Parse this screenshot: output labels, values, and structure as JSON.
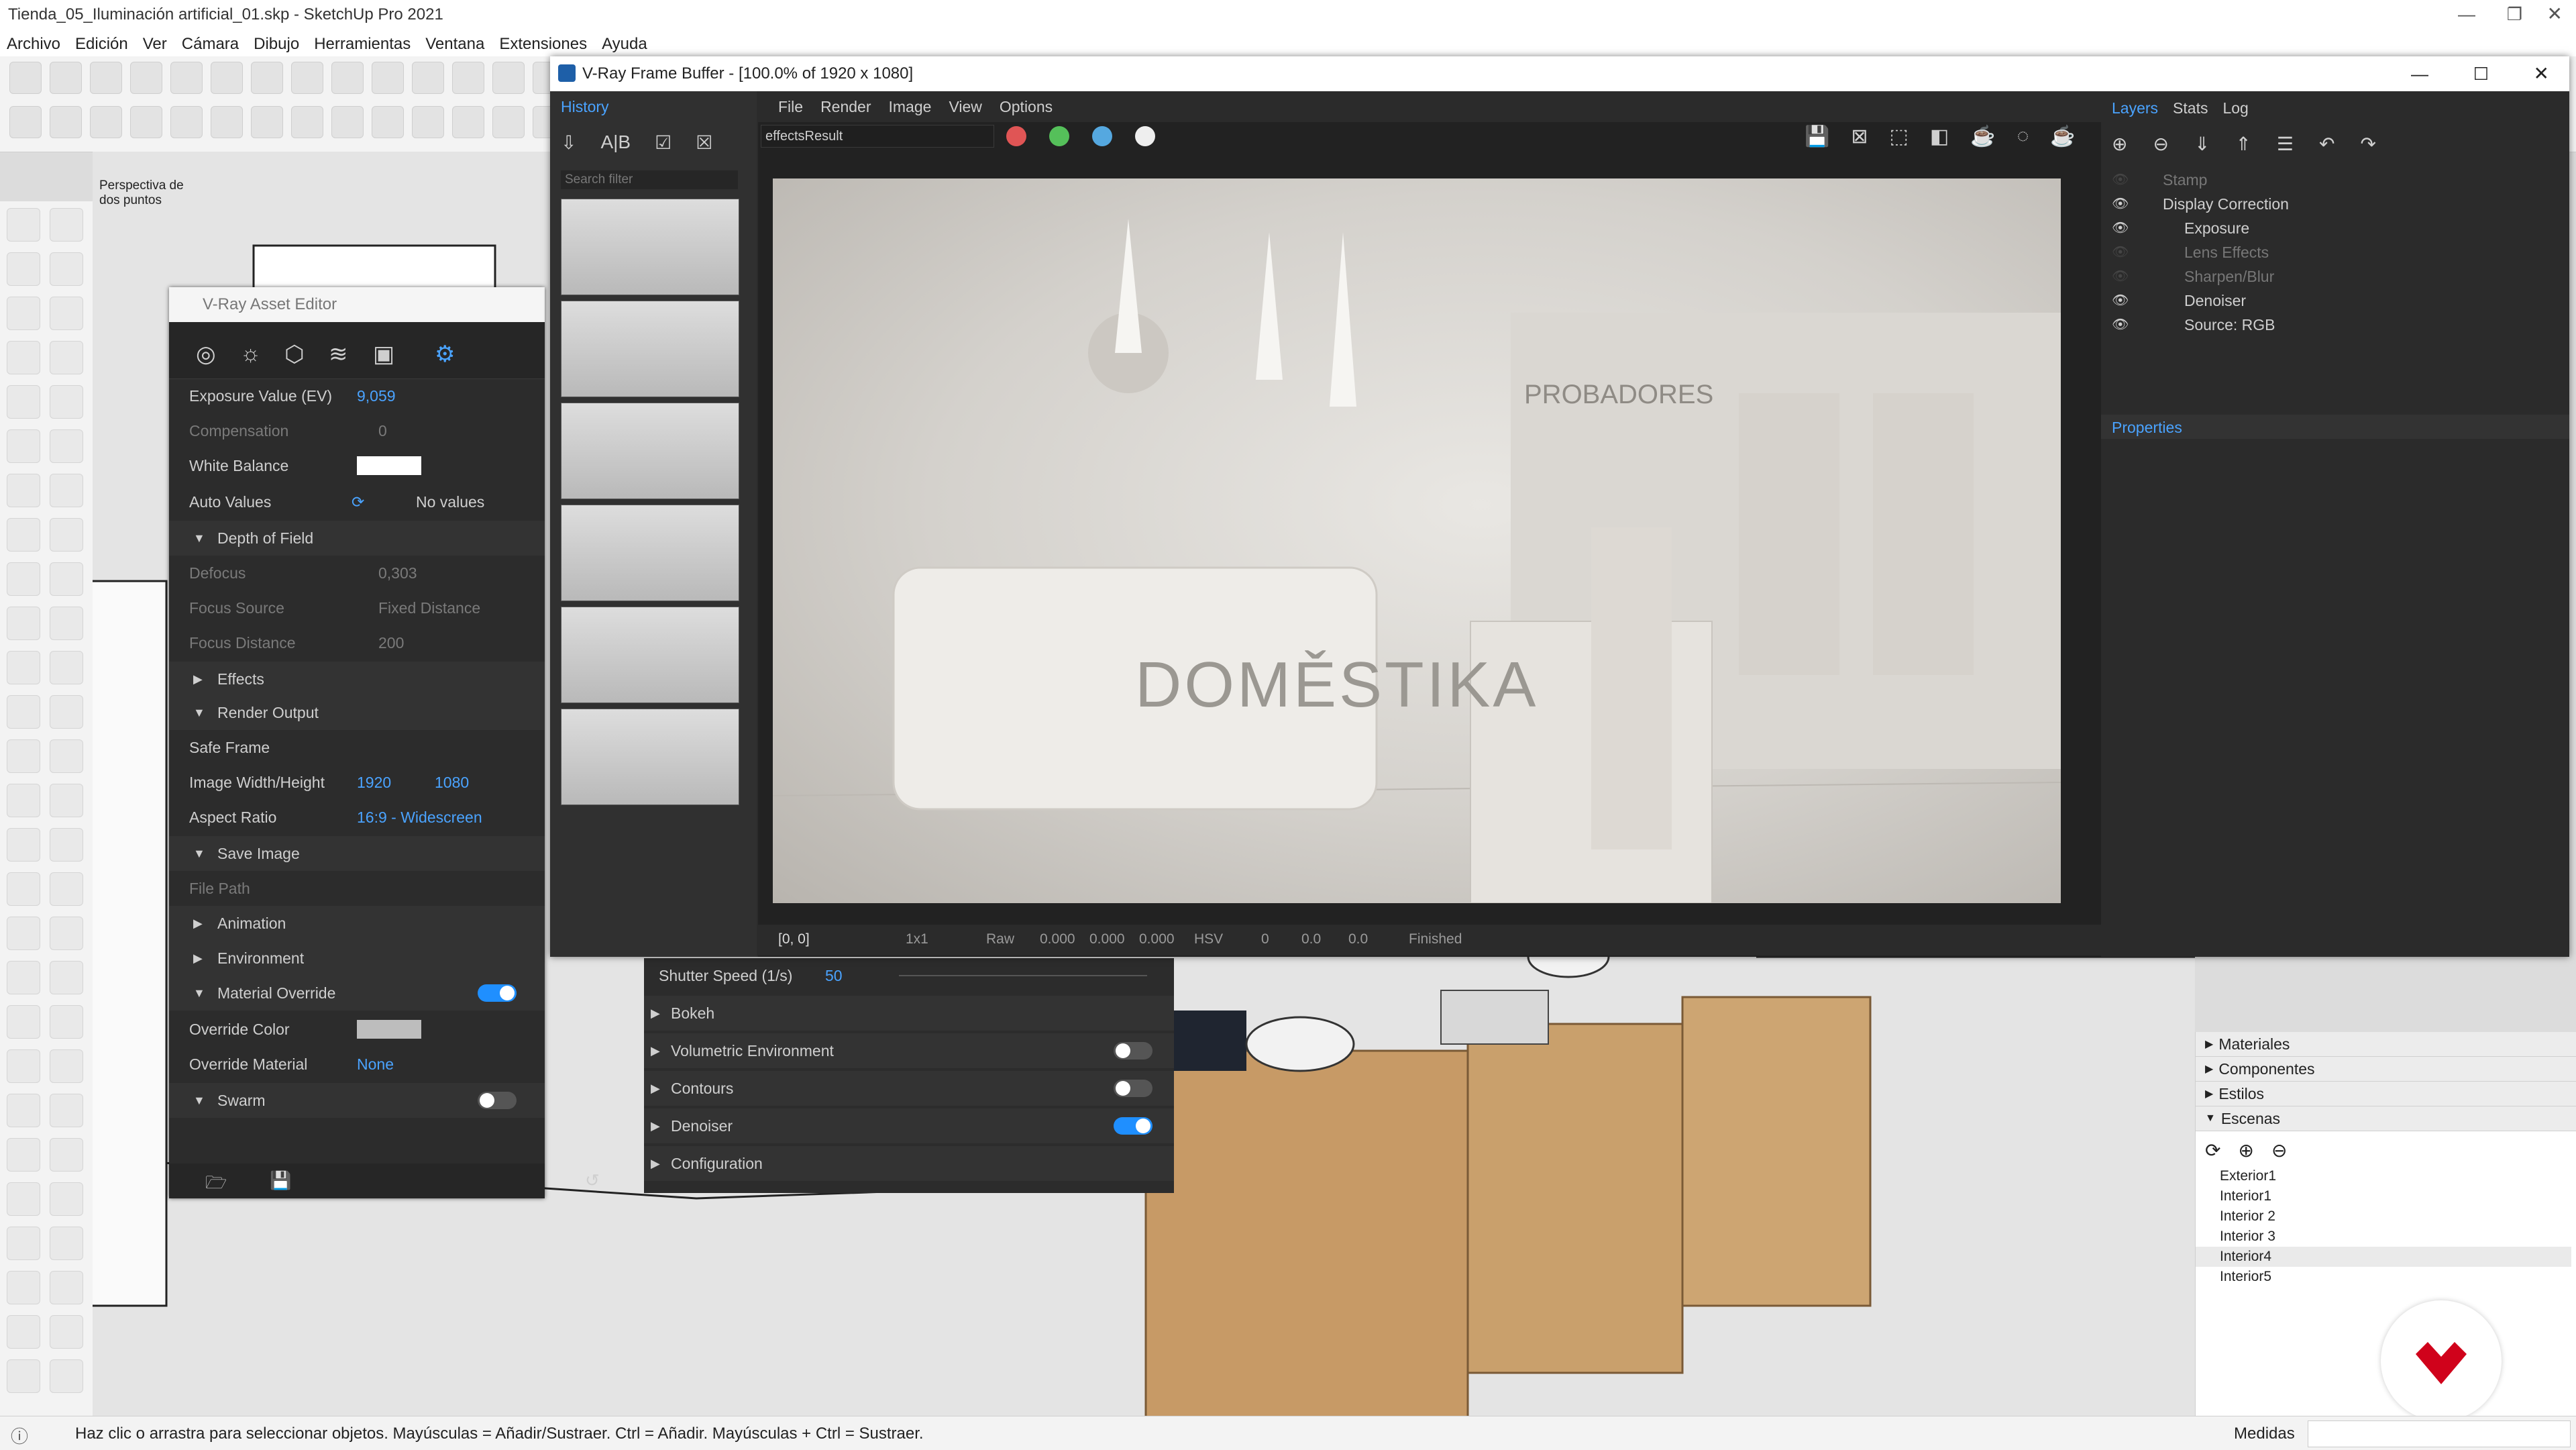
{
  "app": {
    "title": "Tienda_05_Iluminación artificial_01.skp - SketchUp Pro 2021",
    "menus": [
      "Archivo",
      "Edición",
      "Ver",
      "Cámara",
      "Dibujo",
      "Herramientas",
      "Ventana",
      "Extensiones",
      "Ayuda"
    ],
    "scene_tabs": [
      "Exterior1",
      "Interior1",
      "Interior 2",
      "Interior 3",
      "Interior4",
      "Interior5"
    ],
    "active_scene_tab": "Interior4",
    "view_label": "Perspectiva de dos puntos",
    "status_hint": "Haz clic o arrastra para seleccionar objetos. Mayúsculas = Añadir/Sustraer. Ctrl = Añadir. Mayúsculas + Ctrl = Sustraer.",
    "measurements_label": "Medidas"
  },
  "tray": {
    "panels": [
      "Materiales",
      "Componentes",
      "Estilos",
      "Escenas"
    ],
    "expanded": "Escenas",
    "scenes": [
      "Exterior1",
      "Interior1",
      "Interior 2",
      "Interior 3",
      "Interior4",
      "Interior5"
    ],
    "current_scene": "Interior4"
  },
  "asset_editor": {
    "title": "V-Ray Asset Editor",
    "rows": {
      "exposure": {
        "label": "Exposure Value (EV)",
        "value": "9,059"
      },
      "compensation": {
        "label": "Compensation",
        "value": "0"
      },
      "white_balance": {
        "label": "White Balance"
      },
      "auto_values": {
        "label": "Auto Values",
        "value": "No values available"
      },
      "dof": {
        "label": "Depth of Field"
      },
      "defocus": {
        "label": "Defocus",
        "value": "0,303"
      },
      "focus_source": {
        "label": "Focus Source",
        "value": "Fixed Distance"
      },
      "focus_distance": {
        "label": "Focus Distance",
        "value": "200"
      },
      "effects": {
        "label": "Effects"
      },
      "render_output": {
        "label": "Render Output"
      },
      "safe_frame": {
        "label": "Safe Frame"
      },
      "image_wh": {
        "label": "Image Width/Height",
        "width": "1920",
        "height": "1080"
      },
      "aspect": {
        "label": "Aspect Ratio",
        "value": "16:9 - Widescreen"
      },
      "save_image": {
        "label": "Save Image"
      },
      "file_path": {
        "label": "File Path"
      },
      "animation": {
        "label": "Animation"
      },
      "environment": {
        "label": "Environment"
      },
      "material_override": {
        "label": "Material Override",
        "enabled": true
      },
      "override_color": {
        "label": "Override Color"
      },
      "override_material": {
        "label": "Override Material",
        "value": "None"
      },
      "swarm": {
        "label": "Swarm",
        "enabled": false
      }
    }
  },
  "camera_panel": {
    "shutter": {
      "label": "Shutter Speed (1/s)",
      "value": "50"
    },
    "sections": [
      {
        "label": "Bokeh"
      },
      {
        "label": "Volumetric Environment",
        "enabled": false
      },
      {
        "label": "Contours",
        "enabled": false
      },
      {
        "label": "Denoiser",
        "enabled": true
      },
      {
        "label": "Configuration"
      }
    ]
  },
  "vfb": {
    "title": "V-Ray Frame Buffer - [100.0% of 1920 x 1080]",
    "history_tab": "History",
    "search_placeholder": "Search filter",
    "menus": [
      "File",
      "Render",
      "Image",
      "View",
      "Options"
    ],
    "channel": "effectsResult",
    "status": {
      "coords": "[0, 0]",
      "zoom": "1x1",
      "raw": "Raw",
      "r": "0.000",
      "g": "0.000",
      "b": "0.000",
      "mode": "HSV",
      "h": "0",
      "s": "0.0",
      "v": "0.0",
      "state": "Finished"
    },
    "render": {
      "brand": "DOMĚSTIKA",
      "sign": "PROBADORES"
    },
    "layers_tabs": [
      "Layers",
      "Stats",
      "Log"
    ],
    "layers": [
      {
        "name": "Stamp",
        "enabled": false,
        "indent": 1
      },
      {
        "name": "Display Correction",
        "enabled": true,
        "indent": 1
      },
      {
        "name": "Exposure",
        "enabled": true,
        "indent": 2
      },
      {
        "name": "Lens Effects",
        "enabled": false,
        "indent": 2
      },
      {
        "name": "Sharpen/Blur",
        "enabled": false,
        "indent": 2
      },
      {
        "name": "Denoiser",
        "enabled": true,
        "indent": 2
      },
      {
        "name": "Source: RGB",
        "enabled": true,
        "indent": 2
      }
    ],
    "properties_label": "Properties"
  },
  "colors": {
    "accent": "#4aa3ff",
    "toggle_on": "#1f8fff",
    "brand_logo": "#d0021b"
  }
}
